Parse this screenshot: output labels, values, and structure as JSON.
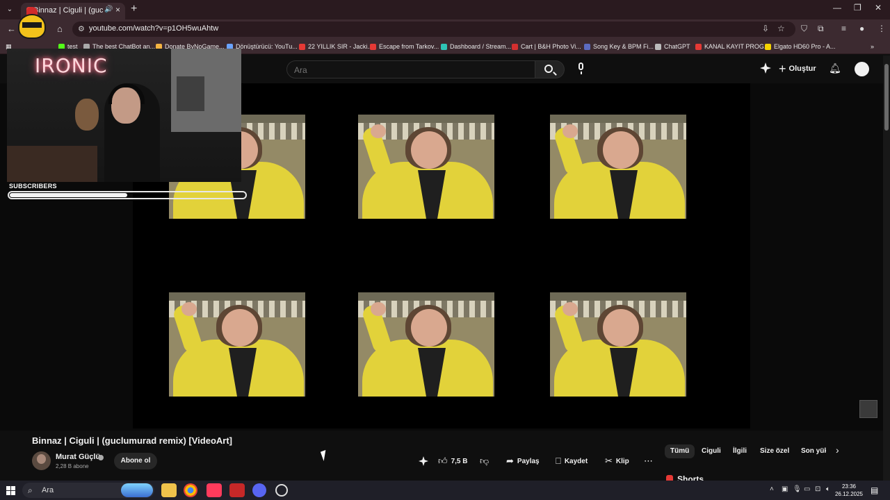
{
  "browser": {
    "tab_title": "Binnaz | Ciguli | (guclumura",
    "url": "youtube.com/watch?v=p1OH5wuAhtw",
    "bookmarks": [
      "test",
      "The best ChatBot an...",
      "Donate ByNoGame...",
      "Dönüştürücü: YouTu...",
      "22 YILLIK SIR - Jacki...",
      "Escape from Tarkov...",
      "Dashboard / Stream...",
      "Cart | B&H Photo Vi...",
      "Song Key & BPM Fi...",
      "ChatGPT",
      "KANAL KAYIT PROG...",
      "Elgato HD60 Pro - A..."
    ]
  },
  "youtube": {
    "search_placeholder": "Ara",
    "create_label": "Oluştur"
  },
  "overlay": {
    "neon_text": "IRONIC",
    "subscribers_label": "SUBSCRIBERS",
    "subscribers_progress": 0.5
  },
  "video": {
    "title": "Binnaz | Ciguli | (guclumurad remix) [VideoArt]",
    "channel_name": "Murat Güçlü",
    "subscriber_count": "2,28 B abone",
    "subscribe_label": "Abone ol",
    "like_count": "7,5 B",
    "share_label": "Paylaş",
    "save_label": "Kaydet",
    "clip_label": "Klip"
  },
  "chips": [
    "Tümü",
    "Ciguli",
    "İlgili",
    "Size özel",
    "Son yükl"
  ],
  "shorts_label": "Shorts",
  "taskbar": {
    "search_label": "Ara",
    "time": "23:36",
    "date": "26.12.2025"
  }
}
